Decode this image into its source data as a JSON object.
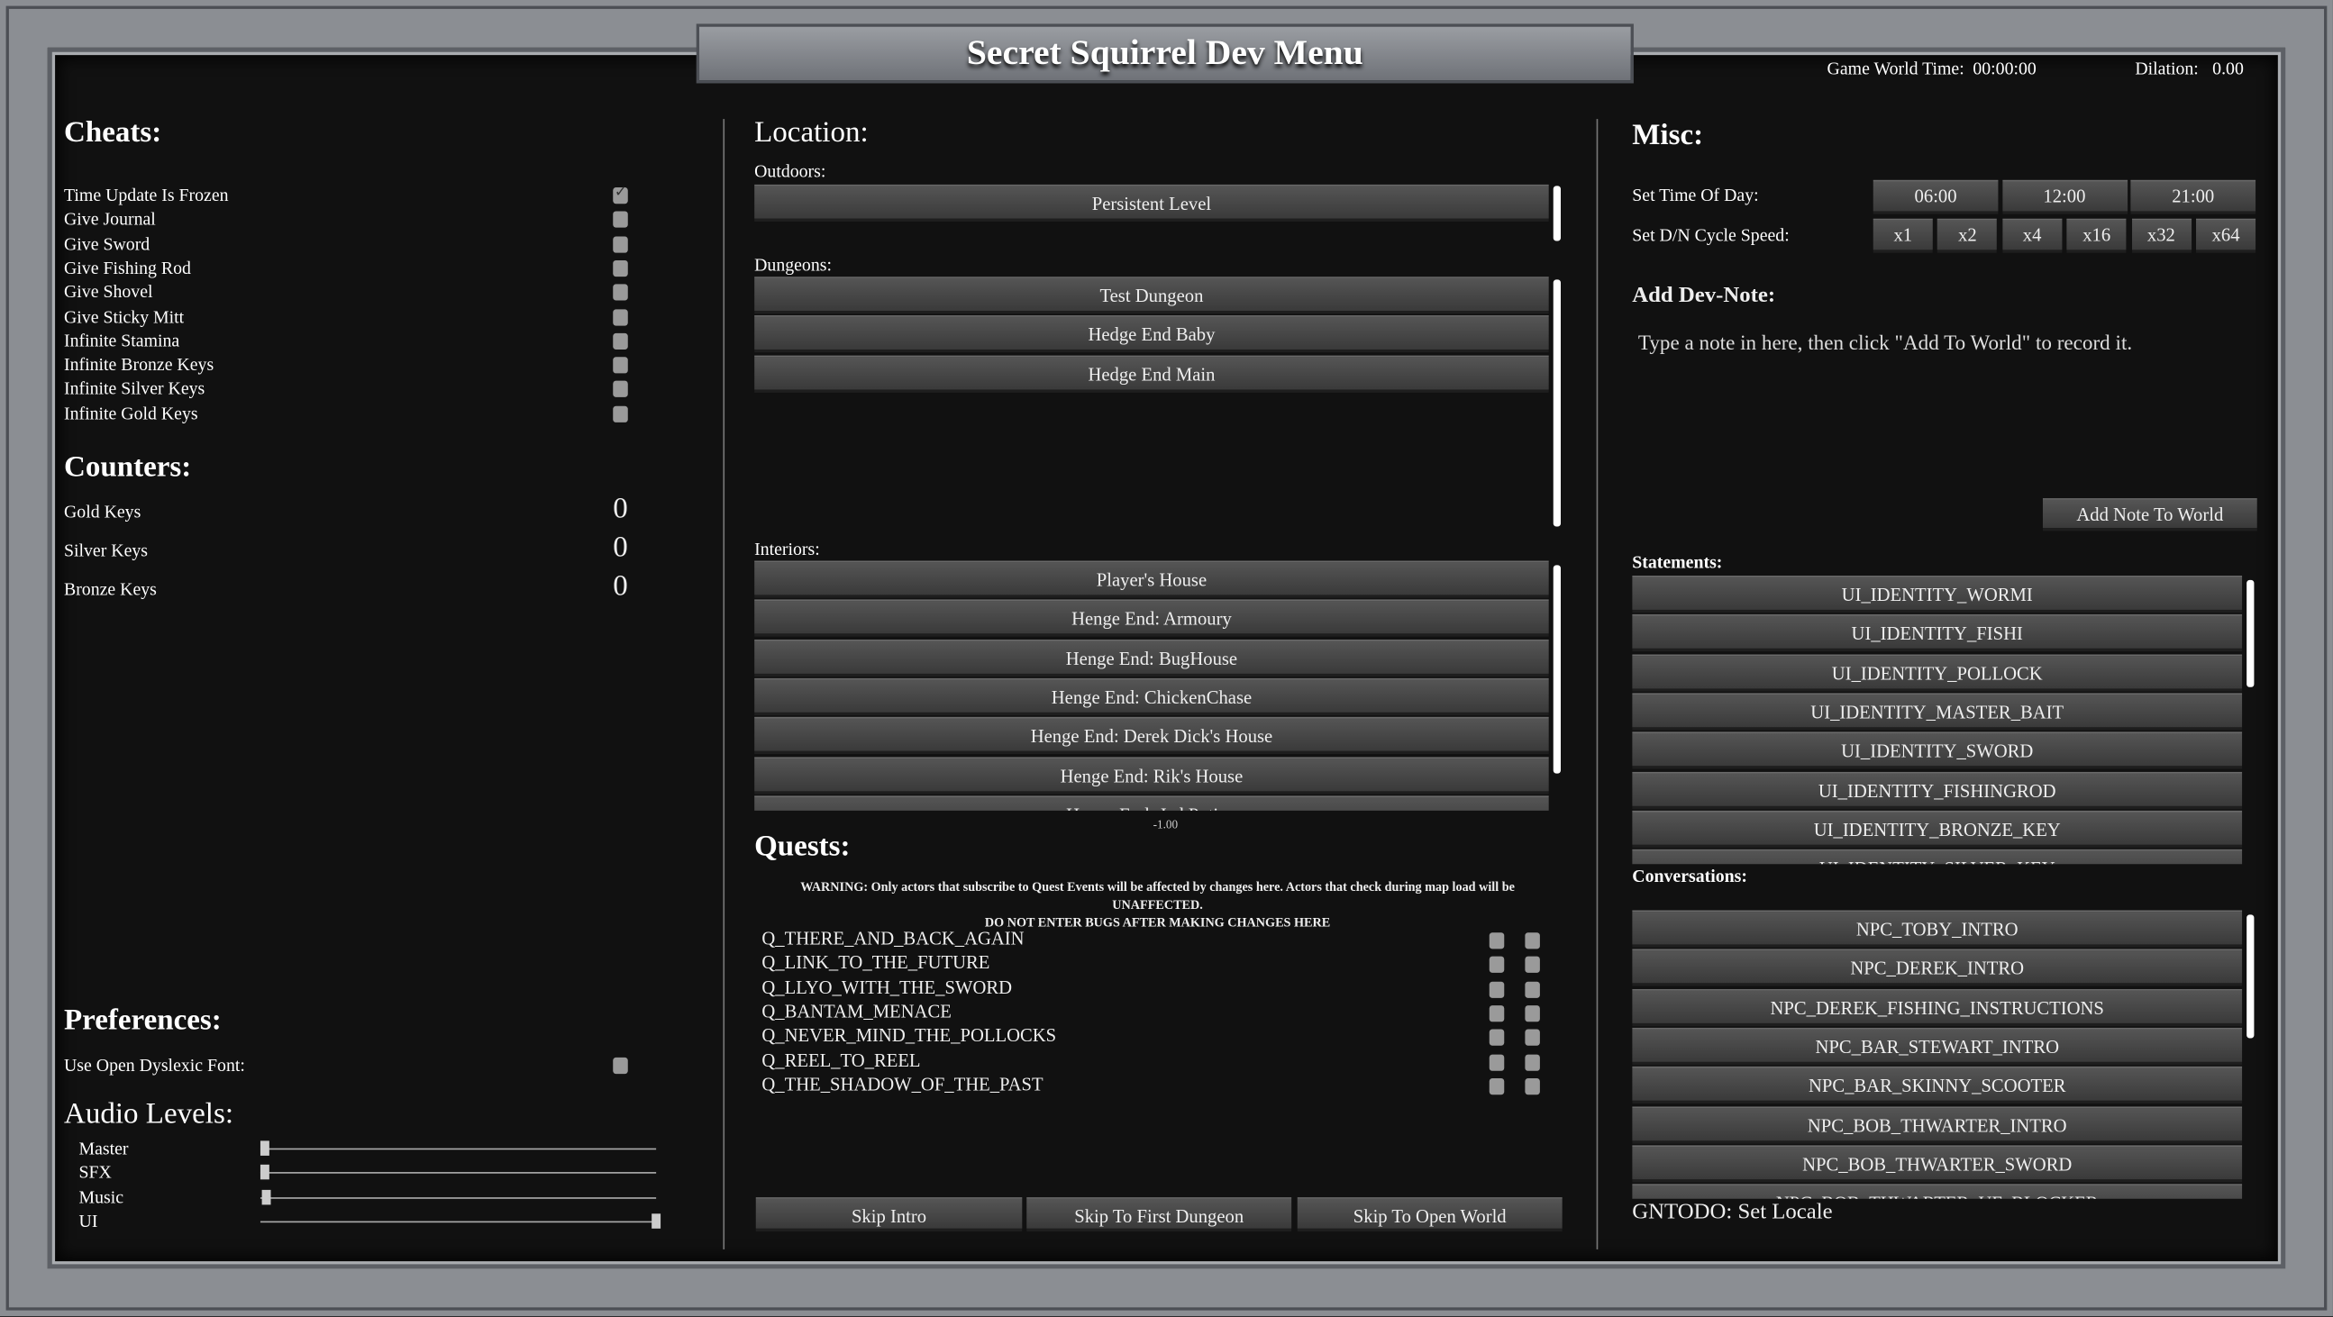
{
  "title": "Secret Squirrel Dev Menu",
  "header": {
    "game_world_time_label": "Game World Time:",
    "game_world_time": "00:00:00",
    "dilation_label": "Dilation:",
    "dilation": "0.00"
  },
  "cheats": {
    "heading": "Cheats:",
    "items": [
      {
        "label": "Time Update Is Frozen",
        "checked": true
      },
      {
        "label": "Give Journal",
        "checked": false
      },
      {
        "label": "Give Sword",
        "checked": false
      },
      {
        "label": "Give Fishing Rod",
        "checked": false
      },
      {
        "label": "Give Shovel",
        "checked": false
      },
      {
        "label": "Give Sticky Mitt",
        "checked": false
      },
      {
        "label": "Infinite Stamina",
        "checked": false
      },
      {
        "label": "Infinite Bronze Keys",
        "checked": false
      },
      {
        "label": "Infinite Silver Keys",
        "checked": false
      },
      {
        "label": "Infinite Gold Keys",
        "checked": false
      }
    ]
  },
  "counters": {
    "heading": "Counters:",
    "items": [
      {
        "label": "Gold Keys",
        "value": "0"
      },
      {
        "label": "Silver Keys",
        "value": "0"
      },
      {
        "label": "Bronze Keys",
        "value": "0"
      }
    ]
  },
  "preferences": {
    "heading": "Preferences:",
    "dyslexic_label": "Use Open Dyslexic Font:",
    "dyslexic_checked": false
  },
  "audio": {
    "heading": "Audio Levels:",
    "items": [
      {
        "label": "Master",
        "level": 0
      },
      {
        "label": "SFX",
        "level": 0
      },
      {
        "label": "Music",
        "level": 0.005
      },
      {
        "label": "UI",
        "level": 1
      }
    ]
  },
  "location": {
    "heading": "Location:",
    "outdoors_label": "Outdoors:",
    "outdoors": [
      "Persistent Level"
    ],
    "dungeons_label": "Dungeons:",
    "dungeons": [
      "Test Dungeon",
      "Hedge End Baby",
      "Hedge End Main"
    ],
    "interiors_label": "Interiors:",
    "interiors": [
      "Player's House",
      "Henge End: Armoury",
      "Henge End: BugHouse",
      "Henge End: ChickenChase",
      "Henge End: Derek Dick's House",
      "Henge End: Rik's House",
      "Henge End: Jed Potion"
    ],
    "scroll_value": "-1.00"
  },
  "quests": {
    "heading": "Quests:",
    "warning": "WARNING: Only actors that subscribe to Quest Events will be affected by changes here. Actors that check during map load will be UNAFFECTED.",
    "warning2": "DO NOT ENTER BUGS AFTER MAKING CHANGES HERE",
    "items": [
      "Q_THERE_AND_BACK_AGAIN",
      "Q_LINK_TO_THE_FUTURE",
      "Q_LLYO_WITH_THE_SWORD",
      "Q_BANTAM_MENACE",
      "Q_NEVER_MIND_THE_POLLOCKS",
      "Q_REEL_TO_REEL",
      "Q_THE_SHADOW_OF_THE_PAST"
    ]
  },
  "skip": {
    "intro": "Skip Intro",
    "first_dungeon": "Skip To First Dungeon",
    "open_world": "Skip To Open World"
  },
  "misc": {
    "heading": "Misc:",
    "time_of_day_label": "Set Time Of Day:",
    "times": [
      "06:00",
      "12:00",
      "21:00"
    ],
    "cycle_label": "Set D/N Cycle Speed:",
    "speeds": [
      "x1",
      "x2",
      "x4",
      "x16",
      "x32",
      "x64"
    ],
    "devnote_heading": "Add Dev-Note:",
    "devnote_placeholder": "Type a note in here, then click \"Add To World\" to record it.",
    "add_note": "Add Note To World"
  },
  "statements": {
    "label": "Statements:",
    "items": [
      "UI_IDENTITY_WORMI",
      "UI_IDENTITY_FISHI",
      "UI_IDENTITY_POLLOCK",
      "UI_IDENTITY_MASTER_BAIT",
      "UI_IDENTITY_SWORD",
      "UI_IDENTITY_FISHINGROD",
      "UI_IDENTITY_BRONZE_KEY",
      "UI_IDENTITY_SILVER_KEY"
    ]
  },
  "conversations": {
    "label": "Conversations:",
    "items": [
      "NPC_TOBY_INTRO",
      "NPC_DEREK_INTRO",
      "NPC_DEREK_FISHING_INSTRUCTIONS",
      "NPC_BAR_STEWART_INTRO",
      "NPC_BAR_SKINNY_SCOOTER",
      "NPC_BOB_THWARTER_INTRO",
      "NPC_BOB_THWARTER_SWORD",
      "NPC_BOB_THWARTER_UF_BLOCKER"
    ]
  },
  "footer": {
    "locale": "GNTODO: Set Locale"
  }
}
